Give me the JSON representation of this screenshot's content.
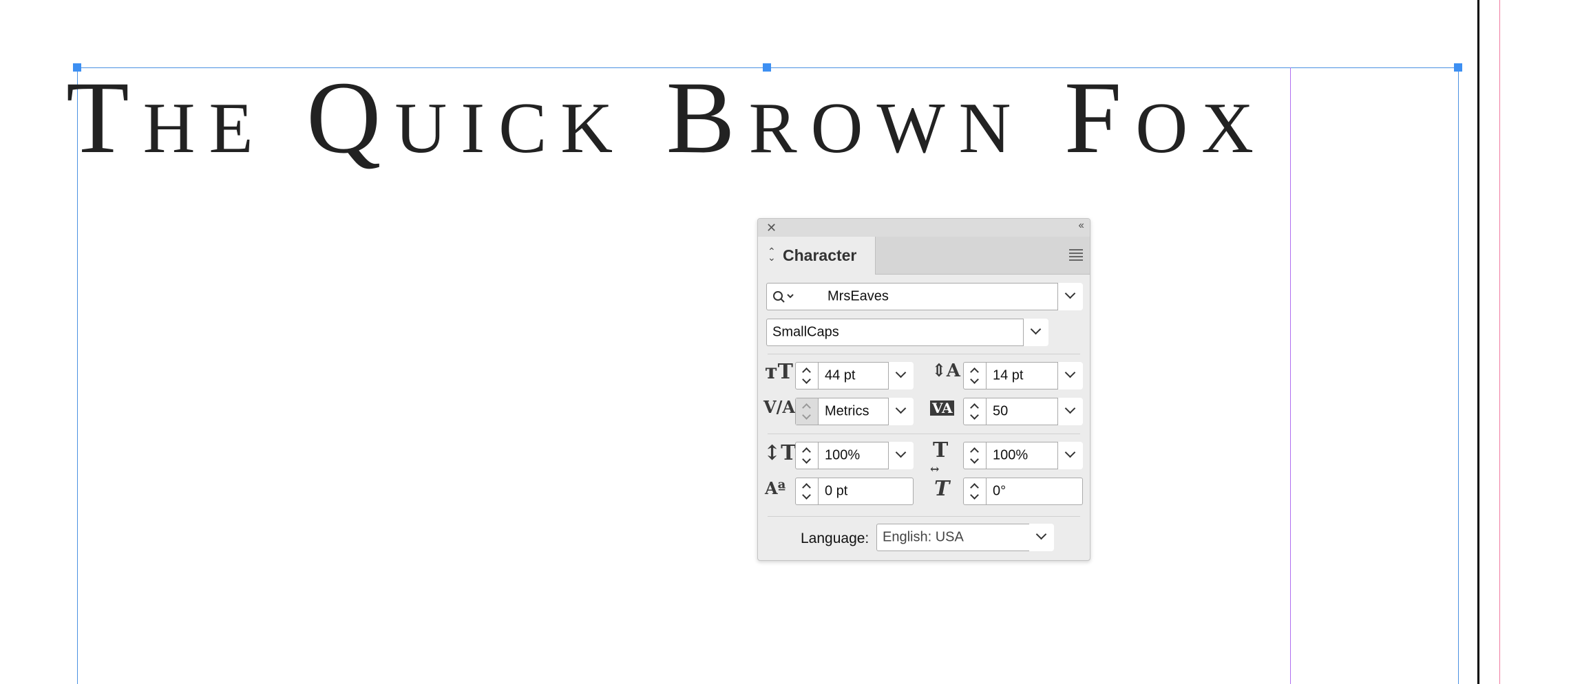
{
  "headline": {
    "text": "The Quick Brown Fox"
  },
  "panel": {
    "tab_label": "Character",
    "icons": {
      "close": "close-icon",
      "collapse": "double-chevron-left-icon",
      "menu": "panel-menu-icon",
      "search": "search-icon"
    },
    "font_family": {
      "value": "MrsEaves"
    },
    "font_style": {
      "value": "SmallCaps"
    },
    "font_size": {
      "value": "44 pt",
      "icon": "font-size-icon"
    },
    "leading": {
      "value": "14 pt",
      "icon": "leading-icon"
    },
    "kerning": {
      "value": "Metrics",
      "icon": "kerning-icon"
    },
    "tracking": {
      "value": "50",
      "icon": "tracking-icon"
    },
    "vertical_scale": {
      "value": "100%",
      "icon": "vertical-scale-icon"
    },
    "horizontal_scale": {
      "value": "100%",
      "icon": "horizontal-scale-icon"
    },
    "baseline_shift": {
      "value": "0 pt",
      "icon": "baseline-shift-icon"
    },
    "skew": {
      "value": "0°",
      "icon": "skew-icon"
    },
    "language": {
      "label": "Language:",
      "value": "English: USA"
    }
  },
  "colors": {
    "frame": "#4a90e2",
    "column_guide": "#b06ef0",
    "bleed_guide": "#f07aa0",
    "panel_bg": "#ececec"
  }
}
